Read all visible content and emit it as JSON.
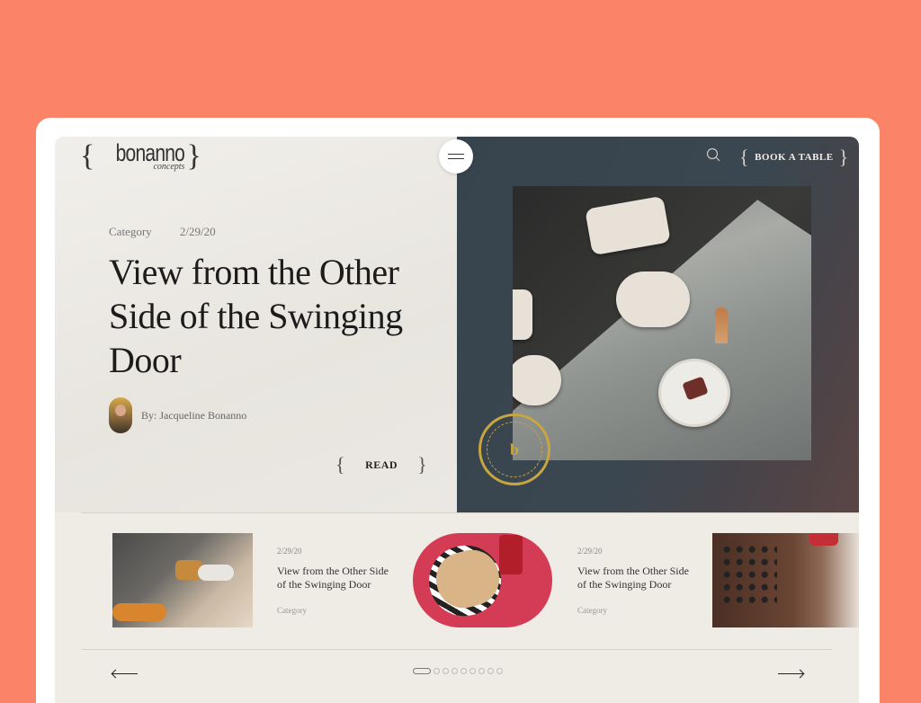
{
  "header": {
    "logo_main": "bonanno",
    "logo_sub": "concepts",
    "book_label": "BOOK A TABLE"
  },
  "hero": {
    "category": "Category",
    "date": "2/29/20",
    "title": "View from the Other Side of the Swinging Door",
    "author": "By: Jacqueline Bonanno",
    "read_label": "READ",
    "stamp_text": "CREATING HAPPY PEOPLE"
  },
  "cards": [
    {
      "date": "2/29/20",
      "title": "View from the Other Side of the Swinging Door",
      "category": "Category"
    },
    {
      "date": "2/29/20",
      "title": "View from the Other Side of the Swinging Door",
      "category": "Category"
    }
  ],
  "slider": {
    "total": 9,
    "active_index": 0
  },
  "colors": {
    "page_bg": "#fb8468",
    "hero_dark": "#37444e",
    "gold": "#c7a640"
  },
  "icons": {
    "search": "search-icon",
    "menu": "hamburger-icon",
    "stamp": "stamp-logo"
  }
}
